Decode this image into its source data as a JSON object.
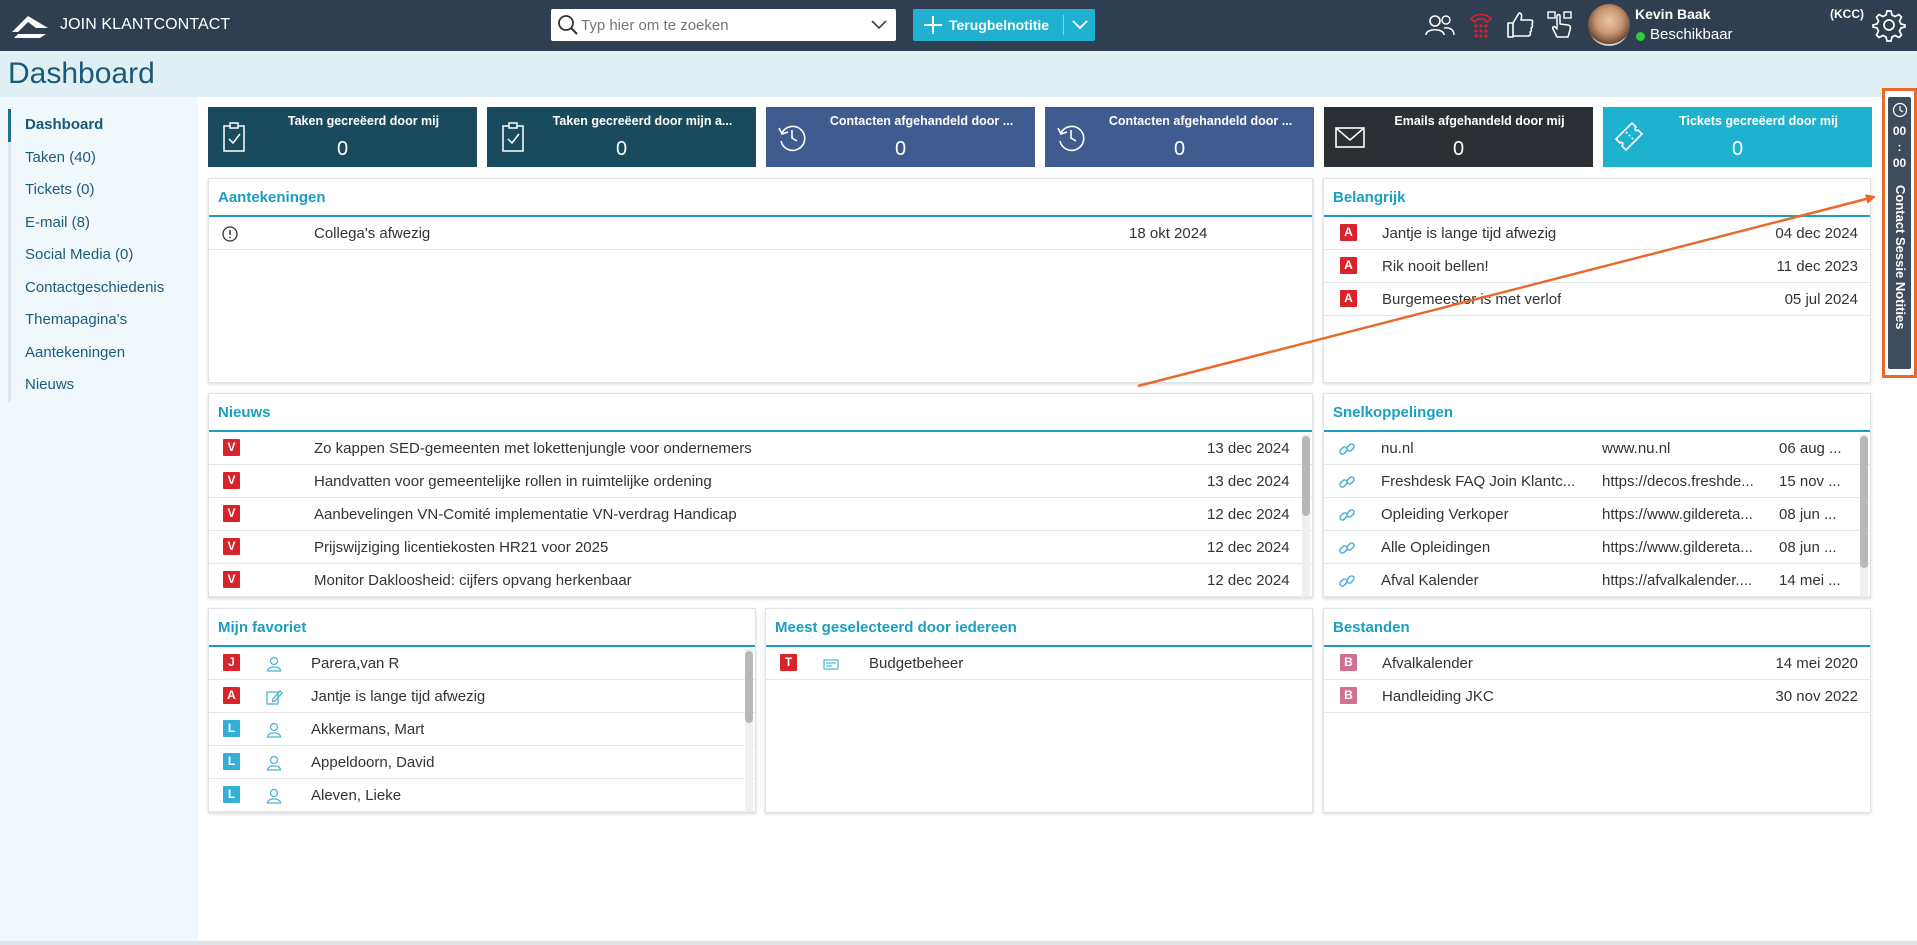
{
  "app": {
    "name": "JOIN KLANTCONTACT"
  },
  "search": {
    "placeholder": "Typ hier om te zoeken"
  },
  "action_button": {
    "label": "Terugbelnotitie"
  },
  "user": {
    "name": "Kevin Baak",
    "status": "Beschikbaar",
    "tag": "(KCC)"
  },
  "page": {
    "title": "Dashboard"
  },
  "sidebar": {
    "items": [
      {
        "label": "Dashboard"
      },
      {
        "label": "Taken (40)"
      },
      {
        "label": "Tickets (0)"
      },
      {
        "label": "E-mail (8)"
      },
      {
        "label": "Social Media (0)"
      },
      {
        "label": "Contactgeschiedenis"
      },
      {
        "label": "Themapagina's"
      },
      {
        "label": "Aantekeningen"
      },
      {
        "label": "Nieuws"
      }
    ]
  },
  "tiles": [
    {
      "label": "Taken gecreëerd door mij",
      "value": "0",
      "color": "#1a4a5e",
      "icon": "clipboard-check-icon"
    },
    {
      "label": "Taken gecreëerd door mijn a...",
      "value": "0",
      "color": "#1a4a5e",
      "icon": "clipboard-check-icon"
    },
    {
      "label": "Contacten afgehandeld door ...",
      "value": "0",
      "color": "#3f5b8f",
      "icon": "history-icon"
    },
    {
      "label": "Contacten afgehandeld door ...",
      "value": "0",
      "color": "#3f5b8f",
      "icon": "history-icon"
    },
    {
      "label": "Emails afgehandeld door mij",
      "value": "0",
      "color": "#2c2f33",
      "icon": "envelope-icon"
    },
    {
      "label": "Tickets gecreëerd door mij",
      "value": "0",
      "color": "#1fb2cf",
      "icon": "ticket-icon"
    }
  ],
  "aantekeningen": {
    "title": "Aantekeningen",
    "rows": [
      {
        "icon": "info-icon",
        "text": "Collega's afwezig",
        "date": "18 okt 2024"
      }
    ]
  },
  "belangrijk": {
    "title": "Belangrijk",
    "rows": [
      {
        "badge": "A",
        "text": "Jantje is lange tijd afwezig",
        "date": "04 dec 2024"
      },
      {
        "badge": "A",
        "text": "Rik nooit bellen!",
        "date": "11 dec 2023"
      },
      {
        "badge": "A",
        "text": "Burgemeester is met verlof",
        "date": "05 jul 2024"
      }
    ]
  },
  "nieuws": {
    "title": "Nieuws",
    "rows": [
      {
        "badge": "V",
        "text": "Zo kappen SED-gemeenten met lokettenjungle voor ondernemers",
        "date": "13 dec 2024"
      },
      {
        "badge": "V",
        "text": "Handvatten voor gemeentelijke rollen in ruimtelijke ordening",
        "date": "13 dec 2024"
      },
      {
        "badge": "V",
        "text": "Aanbevelingen VN-Comité implementatie VN-verdrag Handicap",
        "date": "12 dec 2024"
      },
      {
        "badge": "V",
        "text": "Prijswijziging licentiekosten HR21 voor 2025",
        "date": "12 dec 2024"
      },
      {
        "badge": "V",
        "text": "Monitor Dakloosheid: cijfers opvang herkenbaar",
        "date": "12 dec 2024"
      }
    ]
  },
  "snelkoppelingen": {
    "title": "Snelkoppelingen",
    "rows": [
      {
        "name": "nu.nl",
        "url": "www.nu.nl",
        "date": "06 aug ..."
      },
      {
        "name": "Freshdesk FAQ Join Klantc...",
        "url": "https://decos.freshde...",
        "date": "15 nov ..."
      },
      {
        "name": "Opleiding Verkoper",
        "url": "https://www.gildereta...",
        "date": "08 jun ..."
      },
      {
        "name": "Alle Opleidingen",
        "url": "https://www.gildereta...",
        "date": "08 jun ..."
      },
      {
        "name": "Afval Kalender",
        "url": "https://afvalkalender....",
        "date": "14 mei ..."
      }
    ]
  },
  "favoriet": {
    "title": "Mijn favoriet",
    "rows": [
      {
        "badge": "J",
        "icon": "person-icon",
        "text": "Parera,van R"
      },
      {
        "badge": "A",
        "icon": "edit-note-icon",
        "text": "Jantje is lange tijd afwezig"
      },
      {
        "badge": "L",
        "icon": "person-icon",
        "text": "Akkermans, Mart"
      },
      {
        "badge": "L",
        "icon": "person-icon",
        "text": "Appeldoorn, David"
      },
      {
        "badge": "L",
        "icon": "person-icon",
        "text": "Aleven, Lieke"
      }
    ]
  },
  "meest": {
    "title": "Meest geselecteerd door iedereen",
    "rows": [
      {
        "badge": "T",
        "icon": "card-icon",
        "text": "Budgetbeheer"
      }
    ]
  },
  "bestanden": {
    "title": "Bestanden",
    "rows": [
      {
        "badge": "B",
        "text": "Afvalkalender",
        "date": "14 mei 2020"
      },
      {
        "badge": "B",
        "text": "Handleiding JKC",
        "date": "30 nov 2022"
      }
    ]
  },
  "session_panel": {
    "time_top": "00",
    "time_sep": ":",
    "time_bottom": "00",
    "label": "Contact Sessie Notities"
  },
  "annotation": {
    "color": "#e8692a"
  }
}
